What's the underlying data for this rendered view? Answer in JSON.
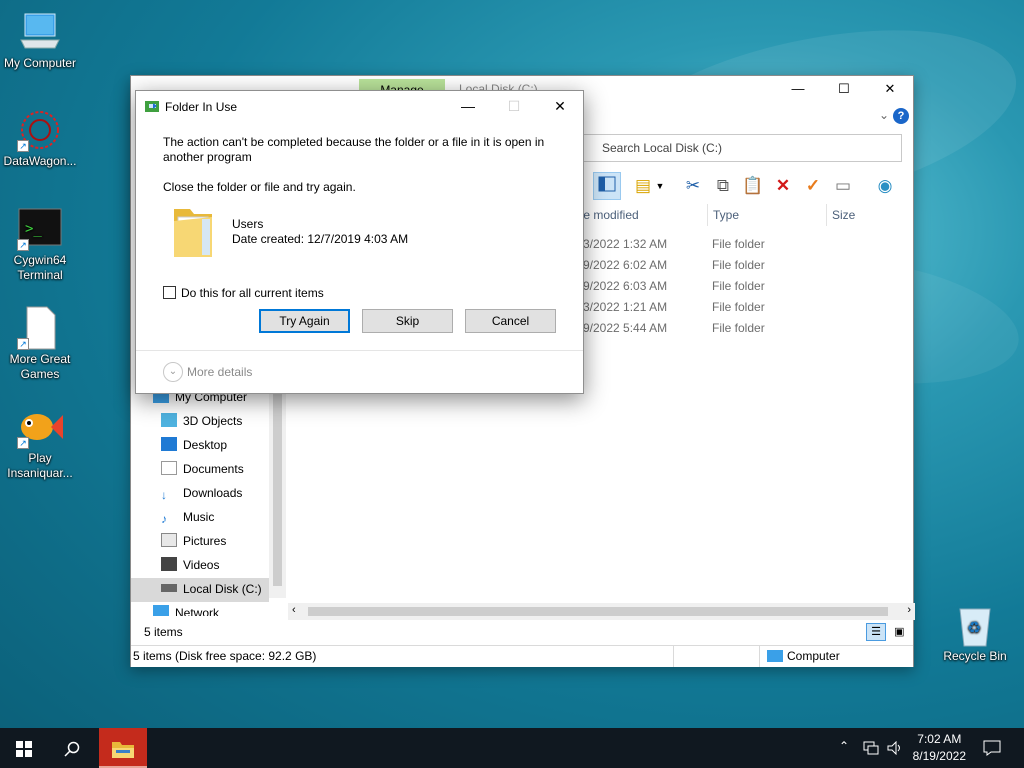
{
  "desktop": {
    "icons": [
      {
        "label": "My Computer"
      },
      {
        "label": "DataWagon..."
      },
      {
        "label": "Cygwin64 Terminal"
      },
      {
        "label": "More Great Games"
      },
      {
        "label": "Play Insaniquar..."
      },
      {
        "label": "Recycle Bin"
      }
    ]
  },
  "explorer": {
    "manage_tab": "Manage",
    "title": "Local Disk (C:)",
    "search_placeholder": "Search Local Disk (C:)",
    "columns": {
      "date": "te modified",
      "type": "Type",
      "size": "Size"
    },
    "rows": [
      {
        "date": "3/2022 1:32 AM",
        "type": "File folder"
      },
      {
        "date": "9/2022 6:02 AM",
        "type": "File folder"
      },
      {
        "date": "9/2022 6:03 AM",
        "type": "File folder"
      },
      {
        "date": "3/2022 1:21 AM",
        "type": "File folder"
      },
      {
        "date": "9/2022 5:44 AM",
        "type": "File folder"
      }
    ],
    "nav": [
      {
        "label": "My Computer"
      },
      {
        "label": "3D Objects"
      },
      {
        "label": "Desktop"
      },
      {
        "label": "Documents"
      },
      {
        "label": "Downloads"
      },
      {
        "label": "Music"
      },
      {
        "label": "Pictures"
      },
      {
        "label": "Videos"
      },
      {
        "label": "Local Disk (C:)"
      },
      {
        "label": "Network"
      }
    ],
    "item_count": "5 items",
    "status_left": "5 items (Disk free space: 92.2 GB)",
    "status_right": "Computer"
  },
  "dialog": {
    "title": "Folder In Use",
    "message": "The action can't be completed because the folder or a file in it is open in another program",
    "instruction": "Close the folder or file and try again.",
    "file_name": "Users",
    "file_date": "Date created: 12/7/2019 4:03 AM",
    "checkbox_label": "Do this for all current items",
    "try_again": "Try Again",
    "skip": "Skip",
    "cancel": "Cancel",
    "more_details": "More details"
  },
  "taskbar": {
    "time": "7:02 AM",
    "date": "8/19/2022"
  },
  "colors": {
    "accent": "#0078d7",
    "taskbar": "#101820",
    "active_taskbar_item": "#c42b1c"
  }
}
